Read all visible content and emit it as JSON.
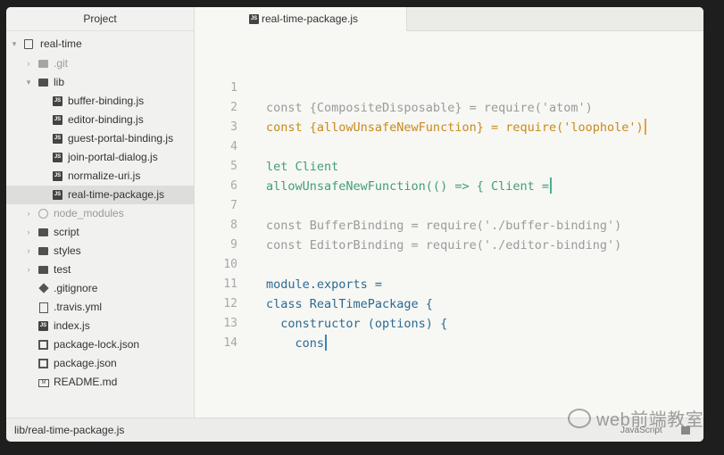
{
  "sidebar": {
    "title": "Project",
    "items": [
      {
        "label": "real-time",
        "icon": "repo-icon"
      },
      {
        "label": ".git",
        "icon": "folder-icon"
      },
      {
        "label": "lib",
        "icon": "folder-icon"
      },
      {
        "label": "buffer-binding.js",
        "icon": "js-file-icon"
      },
      {
        "label": "editor-binding.js",
        "icon": "js-file-icon"
      },
      {
        "label": "guest-portal-binding.js",
        "icon": "js-file-icon"
      },
      {
        "label": "join-portal-dialog.js",
        "icon": "js-file-icon"
      },
      {
        "label": "normalize-uri.js",
        "icon": "js-file-icon"
      },
      {
        "label": "real-time-package.js",
        "icon": "js-file-icon"
      },
      {
        "label": "node_modules",
        "icon": "npm-folder-icon"
      },
      {
        "label": "script",
        "icon": "folder-icon"
      },
      {
        "label": "styles",
        "icon": "folder-icon"
      },
      {
        "label": "test",
        "icon": "folder-icon"
      },
      {
        "label": ".gitignore",
        "icon": "git-icon"
      },
      {
        "label": ".travis.yml",
        "icon": "file-icon"
      },
      {
        "label": "index.js",
        "icon": "js-file-icon"
      },
      {
        "label": "package-lock.json",
        "icon": "book-icon"
      },
      {
        "label": "package.json",
        "icon": "book-icon"
      },
      {
        "label": "README.md",
        "icon": "markdown-icon"
      }
    ]
  },
  "editor": {
    "tab_label": "real-time-package.js",
    "tab_icon_text": "JS",
    "lines": [
      {
        "n": "1",
        "text": "const {CompositeDisposable} = require('atom')"
      },
      {
        "n": "2",
        "text": "const {allowUnsafeNewFunction} = require('loophole')"
      },
      {
        "n": "3",
        "text": ""
      },
      {
        "n": "4",
        "text": "let Client"
      },
      {
        "n": "5",
        "text": "allowUnsafeNewFunction(() => { Client ="
      },
      {
        "n": "6",
        "text": ""
      },
      {
        "n": "7",
        "text": "const BufferBinding = require('./buffer-binding')"
      },
      {
        "n": "8",
        "text": "const EditorBinding = require('./editor-binding')"
      },
      {
        "n": "9",
        "text": ""
      },
      {
        "n": "10",
        "text": "module.exports ="
      },
      {
        "n": "11",
        "text": "class RealTimePackage {"
      },
      {
        "n": "12",
        "text": "  constructor (options) {"
      },
      {
        "n": "13",
        "text": "    cons"
      },
      {
        "n": "14",
        "text": ""
      }
    ],
    "colors": {
      "grey": "#9a9a9a",
      "orange": "#c98a1a",
      "green": "#3f9e7a",
      "blue": "#2b6a93"
    }
  },
  "statusbar": {
    "path": "lib/real-time-package.js",
    "language": "JavaScript"
  },
  "watermark": {
    "text": "web前端教室"
  }
}
